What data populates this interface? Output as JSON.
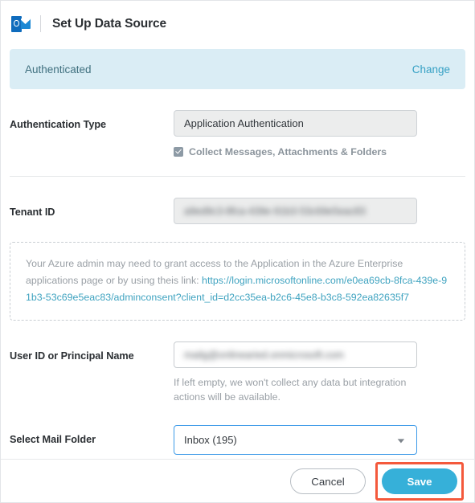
{
  "header": {
    "icon": "outlook-icon",
    "title": "Set Up Data Source"
  },
  "auth_banner": {
    "status": "Authenticated",
    "change_label": "Change"
  },
  "form": {
    "authentication_type": {
      "label": "Authentication Type",
      "value": "Application Authentication"
    },
    "collect_checkbox": {
      "label": "Collect Messages, Attachments & Folders",
      "checked": true
    },
    "tenant_id": {
      "label": "Tenant ID",
      "value": "a9ed9c3-8fca-439e-91b3-53c69e5eac83"
    },
    "user_id": {
      "label": "User ID or Principal Name",
      "value": "mailg@onlinearied.onmicrosoft.com",
      "helper": "If left empty, we won't collect any data but integration actions will be available."
    },
    "mail_folder": {
      "label": "Select Mail Folder",
      "value": "Inbox (195)",
      "caret_icon": "chevron-down-icon"
    }
  },
  "notice": {
    "text_before": "Your Azure admin may need to grant access to the Application in the Azure Enterprise applications page or by using theis link: ",
    "url": "https://login.microsoftonline.com/e0ea69cb-8fca-439e-91b3-53c69e5eac83/adminconsent?client_id=d2cc35ea-b2c6-45e8-b3c8-592ea82635f7"
  },
  "footer": {
    "cancel_label": "Cancel",
    "save_label": "Save"
  },
  "colors": {
    "accent": "#36b0d9",
    "banner_bg": "#daedf5",
    "link": "#3fa3c0",
    "highlight": "#f4593c",
    "focus_border": "#3d9ae8"
  }
}
